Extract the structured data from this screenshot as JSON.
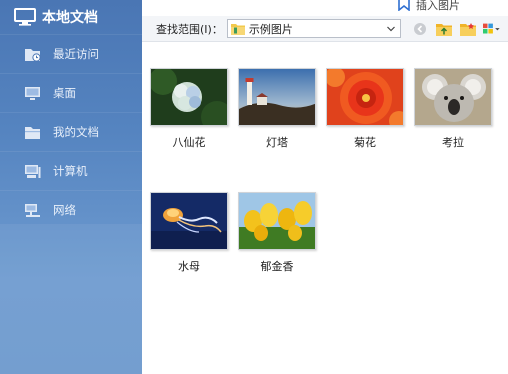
{
  "sidebar": {
    "title": "本地文档",
    "items": [
      {
        "label": "最近访问",
        "icon": "recent-folder-icon"
      },
      {
        "label": "桌面",
        "icon": "desktop-icon"
      },
      {
        "label": "我的文档",
        "icon": "documents-folder-icon"
      },
      {
        "label": "计算机",
        "icon": "computer-icon"
      },
      {
        "label": "网络",
        "icon": "network-icon"
      }
    ]
  },
  "top": {
    "insert_label": "插入图片"
  },
  "toolbar": {
    "look_in_label": "查找范围(I)：",
    "look_in_value": "示例图片",
    "buttons": [
      "back-icon",
      "up-folder-icon",
      "new-folder-icon",
      "view-menu-icon"
    ]
  },
  "files": [
    {
      "name": "八仙花"
    },
    {
      "name": "灯塔"
    },
    {
      "name": "菊花"
    },
    {
      "name": "考拉"
    },
    {
      "name": "水母"
    },
    {
      "name": "郁金香"
    }
  ],
  "colors": {
    "sidebar": "#5584c0",
    "toolbar": "#f3f5f8",
    "accent": "#2f6fd1"
  }
}
